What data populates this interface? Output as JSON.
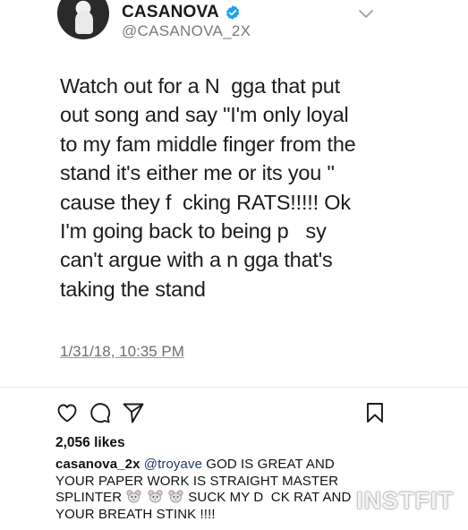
{
  "tweet": {
    "display_name": "CASANOVA",
    "handle": "@CASANOVA_2X",
    "verified_icon": "verified-badge-icon",
    "menu_icon": "chevron-down-icon",
    "lines": [
      "Watch out for a N  gga that put",
      "out song and say \"I'm only loyal",
      "to my fam middle finger from the",
      "stand it's either me or its you \"",
      "cause they f  cking RATS!!!!! Ok",
      "I'm going back to being p   sy",
      "can't argue with a n gga that's",
      "taking the stand"
    ],
    "timestamp": "1/31/18, 10:35 PM",
    "colors": {
      "verified": "#1da1f2",
      "handle": "#7a7a7a"
    }
  },
  "post": {
    "actions": {
      "like_icon": "heart-icon",
      "comment_icon": "comment-icon",
      "share_icon": "send-icon",
      "save_icon": "bookmark-icon"
    },
    "likes": "2,056 likes",
    "caption": {
      "username": "casanova_2x",
      "mention": "@troyave",
      "line1_text": "GOD IS GREAT AND",
      "line2": "YOUR PAPER WORK IS STRAIGHT MASTER",
      "line3_start": "SPLINTER",
      "emoji_name": "rat-emoji",
      "line3_end": "SUCK MY D  CK RAT AND",
      "line4": "YOUR BREATH STINK !!!!"
    }
  },
  "watermark": "INSTFIT"
}
